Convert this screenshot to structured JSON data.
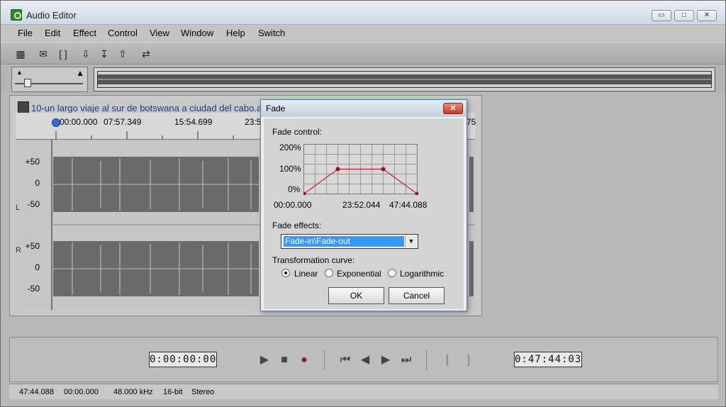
{
  "app": {
    "title": "Audio Editor",
    "window_controls": {
      "minimize": "▭",
      "maximize": "□",
      "close": "✕"
    }
  },
  "menu": [
    "File",
    "Edit",
    "Effect",
    "Control",
    "View",
    "Window",
    "Help",
    "Switch"
  ],
  "toolbar": {
    "icons": [
      "calculator-icon",
      "envelope-icon",
      "bracket-select-icon",
      "mix-down-icon",
      "insert-icon",
      "mix-up-icon",
      "swap-icon"
    ]
  },
  "volume": {
    "level": 0.15
  },
  "document": {
    "title": "10-un largo viaje al sur de botswana a ciudad del cabo.avi",
    "ruler": [
      "00:00.000",
      "07:57.349",
      "15:54.699",
      "23:5",
      "75"
    ],
    "axis_top": [
      "+50",
      "0",
      "-50"
    ],
    "axis_bottom": [
      "+50",
      "0",
      "-50"
    ],
    "channel_left": "L",
    "channel_right": "R"
  },
  "fade_dialog": {
    "title": "Fade",
    "close_label": "✕",
    "fade_control_label": "Fade control:",
    "y_labels": [
      "200%",
      "100%",
      "0%"
    ],
    "x_labels": [
      "00:00.000",
      "23:52.044",
      "47:44.088"
    ],
    "envelope_points": [
      {
        "time_fraction": 0.0,
        "percent": 0
      },
      {
        "time_fraction": 0.3,
        "percent": 100
      },
      {
        "time_fraction": 0.7,
        "percent": 100
      },
      {
        "time_fraction": 1.0,
        "percent": 0
      }
    ],
    "fade_effects_label": "Fade effects:",
    "fade_effects_value": "Fade-in\\Fade-out",
    "transformation_label": "Transformation curve:",
    "curve_options": [
      "Linear",
      "Exponential",
      "Logarithmic"
    ],
    "curve_selected": "Linear",
    "ok_label": "OK",
    "cancel_label": "Cancel"
  },
  "transport": {
    "current_time": "0:00:00:00",
    "total_time": "0:47:44:03"
  },
  "status": {
    "duration": "47:44.088",
    "position": "00:00.000",
    "sample_rate": "48.000 kHz",
    "bit_depth": "16-bit",
    "channels": "Stereo"
  }
}
